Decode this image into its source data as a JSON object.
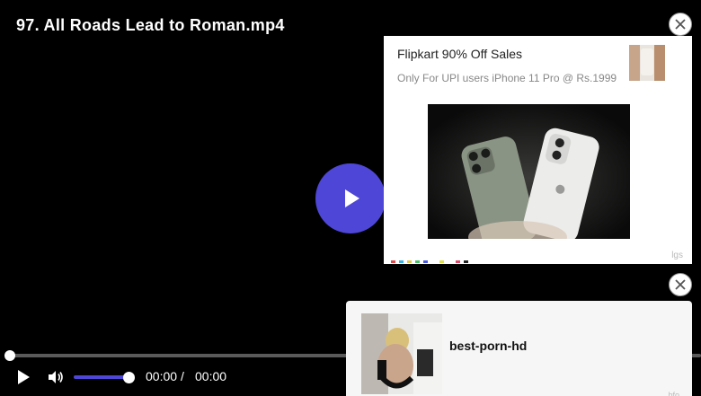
{
  "video": {
    "title": "97. All Roads Lead to Roman.mp4",
    "current_time": "00:00",
    "separator": "/",
    "total_time": "00:00",
    "progress": 0,
    "volume": 1.0
  },
  "colors": {
    "accent": "#4e46d6",
    "background": "#000000"
  },
  "ad_top": {
    "title": "Flipkart 90% Off Sales",
    "description": "Only For UPI users iPhone 11 Pro @ Rs.1999",
    "tag": "lgs"
  },
  "ad_bottom": {
    "title": "best-porn-hd",
    "tag": "bfo"
  },
  "icons": {
    "big_play": "play-icon",
    "play": "play-icon",
    "volume": "volume-icon",
    "zoom": "zoom-in-icon",
    "settings": "gear-icon",
    "pip": "picture-in-picture-icon",
    "cast": "cast-icon",
    "fullscreen": "fullscreen-icon",
    "close": "close-icon"
  }
}
